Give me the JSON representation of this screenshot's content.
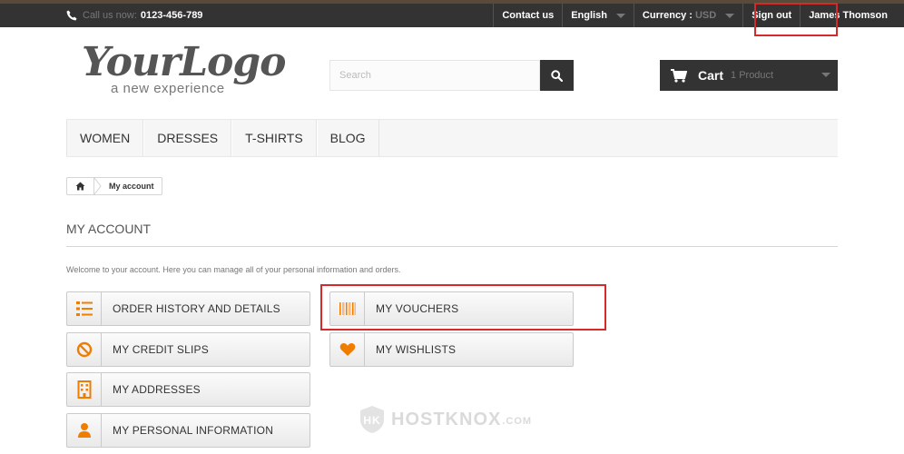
{
  "topbar": {
    "call_label": "Call us now:",
    "phone": "0123-456-789",
    "contact": "Contact us",
    "language": "English",
    "currency_label": "Currency :",
    "currency_value": "USD",
    "sign_out": "Sign out",
    "user": "James Thomson"
  },
  "header": {
    "logo_text": "YourLogo",
    "logo_tagline": "a new experience",
    "search_placeholder": "Search",
    "cart_label": "Cart",
    "cart_qty": "1 Product"
  },
  "menu": [
    "Women",
    "Dresses",
    "T-shirts",
    "Blog"
  ],
  "breadcrumb": {
    "current": "My account"
  },
  "page": {
    "title": "My account",
    "welcome": "Welcome to your account. Here you can manage all of your personal information and orders."
  },
  "account_links": {
    "order_history": "Order history and details",
    "credit_slips": "My credit slips",
    "addresses": "My addresses",
    "personal_info": "My personal information",
    "vouchers": "My vouchers",
    "wishlists": "My wishlists"
  },
  "watermark": {
    "name": "HOSTKNOX",
    "suffix": ".COM"
  },
  "colors": {
    "accent": "#f07d00",
    "dark": "#333333",
    "highlight": "#d42a2a"
  }
}
